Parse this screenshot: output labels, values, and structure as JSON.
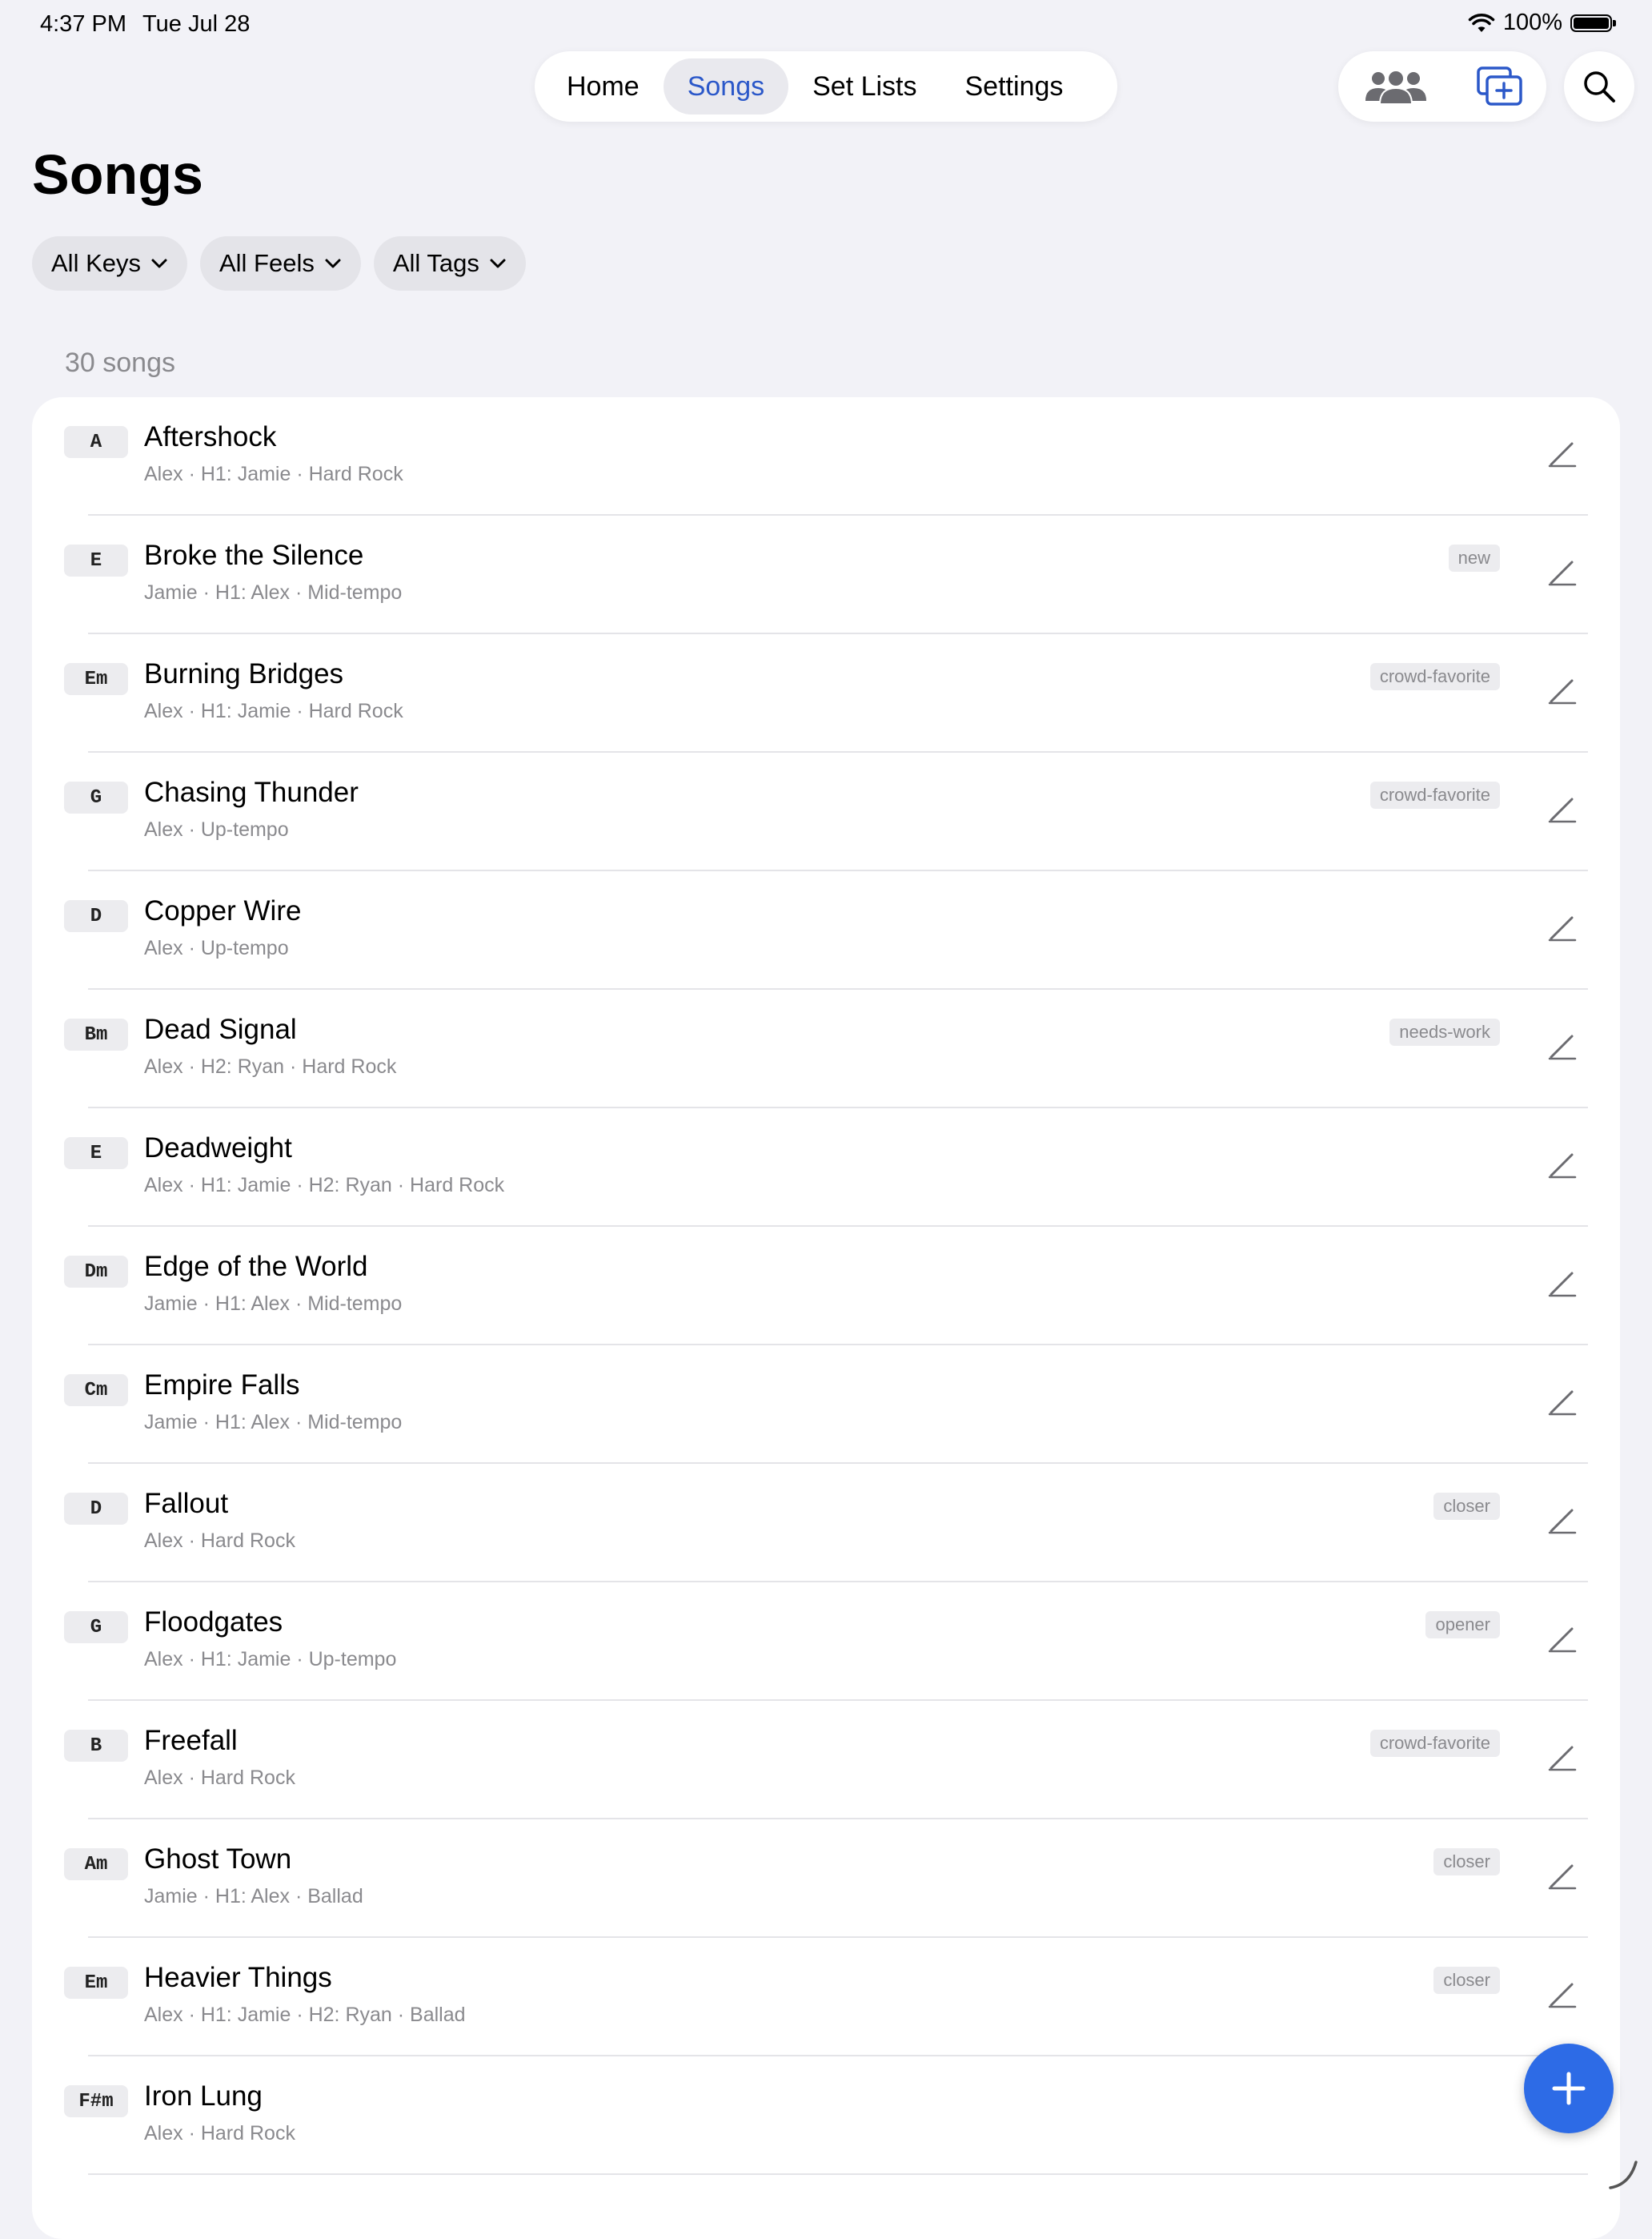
{
  "status": {
    "time": "4:37 PM",
    "date": "Tue Jul 28",
    "battery": "100%"
  },
  "nav": {
    "tabs": [
      "Home",
      "Songs",
      "Set Lists",
      "Settings"
    ],
    "active": "Songs"
  },
  "page": {
    "title": "Songs",
    "count": "30 songs"
  },
  "filters": [
    "All Keys",
    "All Feels",
    "All Tags"
  ],
  "icons": {
    "people": "people-icon",
    "add_window": "add-window-icon",
    "search": "search-icon",
    "edit": "pencil-icon",
    "add": "plus-icon"
  },
  "colors": {
    "accent": "#2b58c9",
    "fab": "#2d6be6",
    "background": "#f2f2f7"
  },
  "songs": [
    {
      "key": "A",
      "title": "Aftershock",
      "meta": "Alex · H1: Jamie · Hard Rock",
      "tag": ""
    },
    {
      "key": "E",
      "title": "Broke the Silence",
      "meta": "Jamie · H1: Alex · Mid-tempo",
      "tag": "new"
    },
    {
      "key": "Em",
      "title": "Burning Bridges",
      "meta": "Alex · H1: Jamie · Hard Rock",
      "tag": "crowd-favorite"
    },
    {
      "key": "G",
      "title": "Chasing Thunder",
      "meta": "Alex · Up-tempo",
      "tag": "crowd-favorite"
    },
    {
      "key": "D",
      "title": "Copper Wire",
      "meta": "Alex · Up-tempo",
      "tag": ""
    },
    {
      "key": "Bm",
      "title": "Dead Signal",
      "meta": "Alex · H2: Ryan · Hard Rock",
      "tag": "needs-work"
    },
    {
      "key": "E",
      "title": "Deadweight",
      "meta": "Alex · H1: Jamie · H2: Ryan · Hard Rock",
      "tag": ""
    },
    {
      "key": "Dm",
      "title": "Edge of the World",
      "meta": "Jamie · H1: Alex · Mid-tempo",
      "tag": ""
    },
    {
      "key": "Cm",
      "title": "Empire Falls",
      "meta": "Jamie · H1: Alex · Mid-tempo",
      "tag": ""
    },
    {
      "key": "D",
      "title": "Fallout",
      "meta": "Alex · Hard Rock",
      "tag": "closer"
    },
    {
      "key": "G",
      "title": "Floodgates",
      "meta": "Alex · H1: Jamie · Up-tempo",
      "tag": "opener"
    },
    {
      "key": "B",
      "title": "Freefall",
      "meta": "Alex · Hard Rock",
      "tag": "crowd-favorite"
    },
    {
      "key": "Am",
      "title": "Ghost Town",
      "meta": "Jamie · H1: Alex · Ballad",
      "tag": "closer"
    },
    {
      "key": "Em",
      "title": "Heavier Things",
      "meta": "Alex · H1: Jamie · H2: Ryan · Ballad",
      "tag": "closer"
    },
    {
      "key": "F#m",
      "title": "Iron Lung",
      "meta": "Alex · Hard Rock",
      "tag": ""
    }
  ]
}
